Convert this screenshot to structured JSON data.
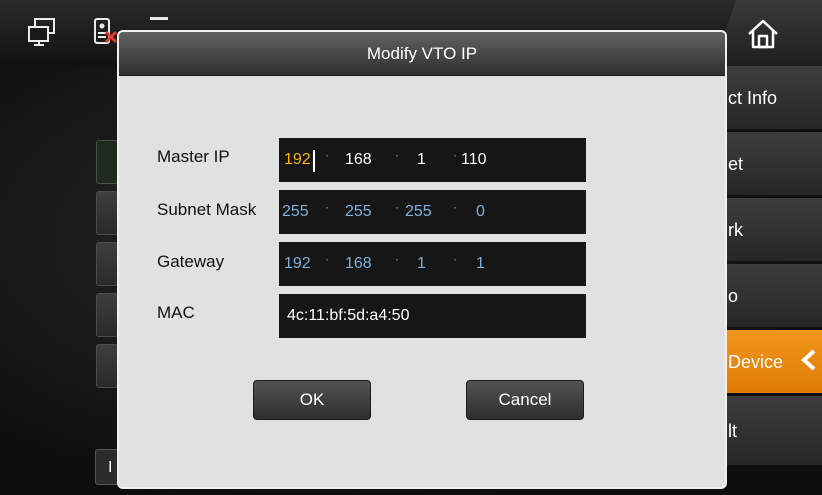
{
  "dialog": {
    "title": "Modify VTO IP",
    "fields": [
      {
        "label": "Master IP",
        "octets": [
          "192",
          "168",
          "1",
          "110"
        ]
      },
      {
        "label": "Subnet Mask",
        "octets": [
          "255",
          "255",
          "255",
          "0"
        ]
      },
      {
        "label": "Gateway",
        "octets": [
          "192",
          "168",
          "1",
          "1"
        ]
      },
      {
        "label": "MAC",
        "value": "4c:11:bf:5d:a4:50"
      }
    ],
    "separator": "·",
    "ok_label": "OK",
    "cancel_label": "Cancel"
  },
  "sidebar": {
    "items": [
      {
        "label": "ct Info"
      },
      {
        "label": "et"
      },
      {
        "label": "rk"
      },
      {
        "label": "o"
      },
      {
        "label": "Device",
        "active": true
      },
      {
        "label": "lt"
      }
    ]
  },
  "background": {
    "partial_button_label": "I"
  },
  "colors": {
    "accent": "#F29112",
    "active_octet": "#F6B300",
    "muted_octet": "#7FB0DA"
  },
  "icons": [
    "monitor-icon",
    "device-icon",
    "menu-icon",
    "home-icon",
    "chevron-left-icon"
  ]
}
